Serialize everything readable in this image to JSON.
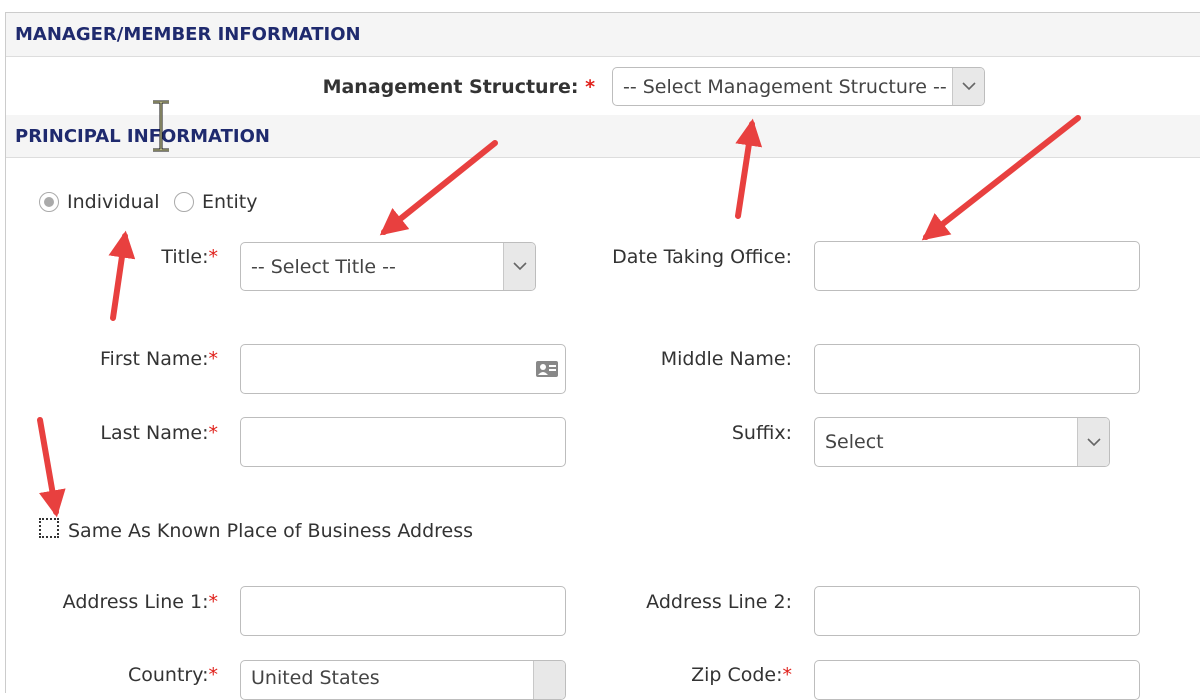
{
  "sections": {
    "manager_member": "MANAGER/MEMBER INFORMATION",
    "principal": "PRINCIPAL INFORMATION"
  },
  "management_structure": {
    "label": "Management Structure:",
    "required": "*",
    "value": "-- Select Management Structure --"
  },
  "principal_type": {
    "options": [
      "Individual",
      "Entity"
    ],
    "selected": "Individual"
  },
  "fields": {
    "title": {
      "label": "Title:",
      "required": "*",
      "value": "-- Select Title --"
    },
    "date_taking_office": {
      "label": "Date Taking Office:",
      "value": ""
    },
    "first_name": {
      "label": "First Name:",
      "required": "*",
      "value": ""
    },
    "middle_name": {
      "label": "Middle Name:",
      "value": ""
    },
    "last_name": {
      "label": "Last Name:",
      "required": "*",
      "value": ""
    },
    "suffix": {
      "label": "Suffix:",
      "value": "Select"
    },
    "address_line_1": {
      "label": "Address Line 1:",
      "required": "*",
      "value": ""
    },
    "address_line_2": {
      "label": "Address Line 2:",
      "value": ""
    },
    "country": {
      "label": "Country:",
      "required": "*",
      "value": "United States"
    },
    "zip_code": {
      "label": "Zip Code:",
      "required": "*",
      "value": ""
    }
  },
  "same_as_address": {
    "label": "Same As Known Place of Business Address",
    "checked": false
  },
  "colors": {
    "header_text": "#1f2a6e",
    "header_bg": "#f5f5f5",
    "required": "#e0201a",
    "annotation_arrow": "#e8403f"
  },
  "icons": {
    "contact_card": "contact-card-icon",
    "chevron": "chevron-down-icon",
    "cursor": "text-cursor-icon"
  }
}
